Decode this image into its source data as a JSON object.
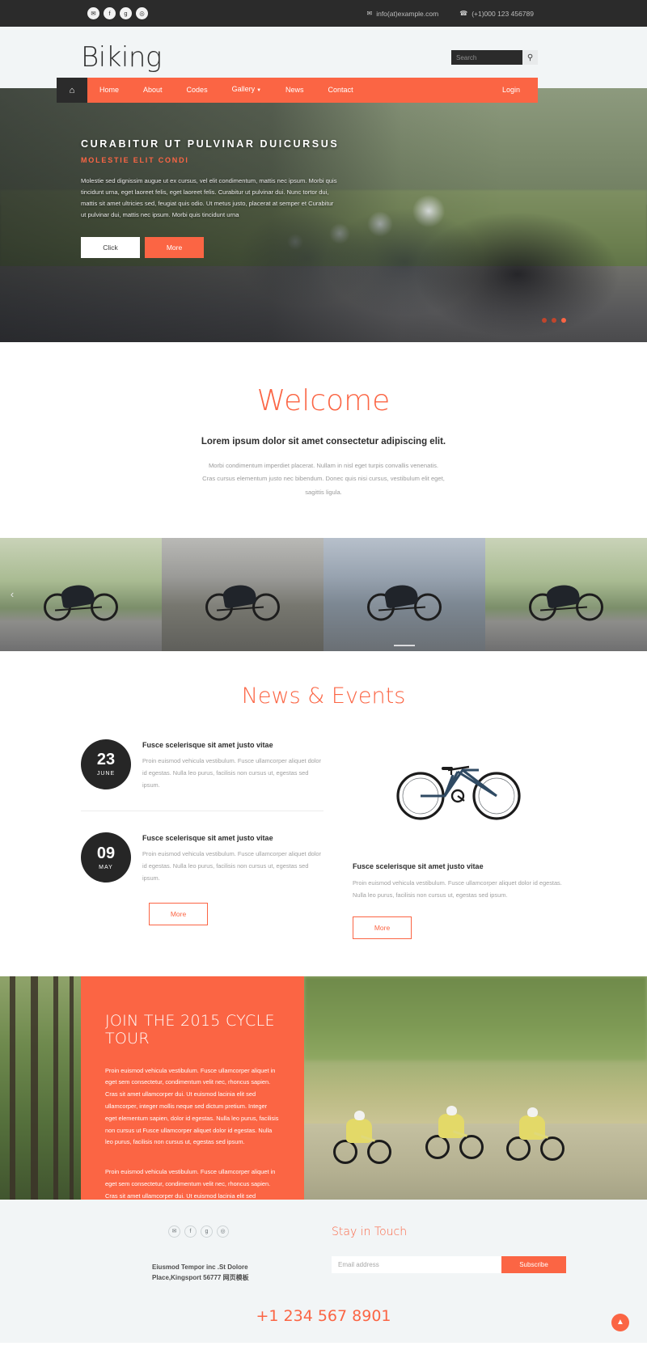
{
  "topbar": {
    "social": [
      {
        "name": "twitter-icon",
        "glyph": "✉"
      },
      {
        "name": "facebook-icon",
        "glyph": "f"
      },
      {
        "name": "googleplus-icon",
        "glyph": "g"
      },
      {
        "name": "dribbble-icon",
        "glyph": "◎"
      }
    ],
    "email": "info(at)example.com",
    "phone": "(+1)000 123 456789"
  },
  "header": {
    "logo": "Biking",
    "search_placeholder": "Search",
    "search_value": ""
  },
  "nav": {
    "home_icon": "home-icon",
    "items": [
      {
        "label": "Home",
        "active": true,
        "caret": false
      },
      {
        "label": "About",
        "active": false,
        "caret": false
      },
      {
        "label": "Codes",
        "active": false,
        "caret": false
      },
      {
        "label": "Gallery",
        "active": false,
        "caret": true
      },
      {
        "label": "News",
        "active": false,
        "caret": false
      },
      {
        "label": "Contact",
        "active": false,
        "caret": false
      }
    ],
    "login": "Login"
  },
  "banner": {
    "title": "CURABITUR UT PULVINAR DUICURSUS",
    "subtitle": "MOLESTIE ELIT CONDI",
    "text": "Molestie sed dignissim augue ut ex cursus, vel elit condimentum, mattis nec ipsum. Morbi quis tincidunt urna, eget laoreet felis, eget laoreet felis. Curabitur ut pulvinar dui. Nunc tortor dui, mattis sit amet ultricies sed, feugiat quis odio. Ut metus justo, placerat at semper et Curabitur ut pulvinar dui, mattis nec ipsum. Morbi quis tincidunt urna",
    "btn_click": "Click",
    "btn_more": "More",
    "dots": 3,
    "active_dot": 2
  },
  "welcome": {
    "title": "Welcome",
    "subtitle": "Lorem ipsum dolor sit amet consectetur adipiscing elit.",
    "text": "Morbi condimentum imperdiet placerat. Nullam in nisl eget turpis convallis venenatis. Cras cursus elementum justo nec bibendum. Donec quis nisi cursus, vestibulum elit eget, sagittis ligula."
  },
  "gallery": {
    "prev_icon": "chevron-left-icon",
    "slides": 4
  },
  "news": {
    "title": "News & Events",
    "items": [
      {
        "day": "23",
        "month": "JUNE",
        "title": "Fusce scelerisque sit amet justo vitae",
        "text": "Proin euismod vehicula vestibulum. Fusce ullamcorper aliquet dolor id egestas. Nulla leo purus, facilisis non cursus ut, egestas sed ipsum."
      },
      {
        "day": "09",
        "month": "MAY",
        "title": "Fusce scelerisque sit amet justo vitae",
        "text": "Proin euismod vehicula vestibulum. Fusce ullamcorper aliquet dolor id egestas. Nulla leo purus, facilisis non cursus ut, egestas sed ipsum."
      }
    ],
    "right": {
      "title": "Fusce scelerisque sit amet justo vitae",
      "text": "Proin euismod vehicula vestibulum. Fusce ullamcorper aliquet dolor id egestas. Nulla leo purus, facilisis non cursus ut, egestas sed ipsum."
    },
    "more_left": "More",
    "more_right": "More"
  },
  "cta": {
    "title": "JOIN THE 2015 CYCLE TOUR",
    "paragraph1": "Proin euismod vehicula vestibulum. Fusce ullamcorper aliquet in eget sem consectetur, condimentum velit nec, rhoncus sapien. Cras sit amet ullamcorper dui. Ut euismod lacinia elit sed ullamcorper, integer mollis neque sed dictum pretium. Integer eget elementum sapien, dolor id egestas. Nulla leo purus, facilisis non cursus ut Fusce ullamcorper aliquet dolor id egestas. Nulla leo purus, facilisis non cursus ut, egestas sed ipsum.",
    "paragraph2": "Proin euismod vehicula vestibulum. Fusce ullamcorper aliquet in eget sem consectetur, condimentum velit nec, rhoncus sapien. Cras sit amet ullamcorper dui. Ut euismod lacinia elit sed ullamcorper, integer mollis neque sed dictum pretium. Integer eget elementum sapien, dolor id egestas. Nulla leo purus."
  },
  "footer": {
    "social": [
      {
        "name": "twitter-icon",
        "glyph": "✉"
      },
      {
        "name": "facebook-icon",
        "glyph": "f"
      },
      {
        "name": "googleplus-icon",
        "glyph": "g"
      },
      {
        "name": "dribbble-icon",
        "glyph": "◎"
      }
    ],
    "address_line1": "Eiusmod Tempor inc .St Dolore",
    "address_line2": "Place,Kingsport 56777 网页模板",
    "stay_title": "Stay in Touch",
    "email_placeholder": "Email address",
    "email_value": "",
    "subscribe": "Subscribe",
    "phone": "+1 234 567 8901",
    "to_top_icon": "chevron-up-icon"
  }
}
